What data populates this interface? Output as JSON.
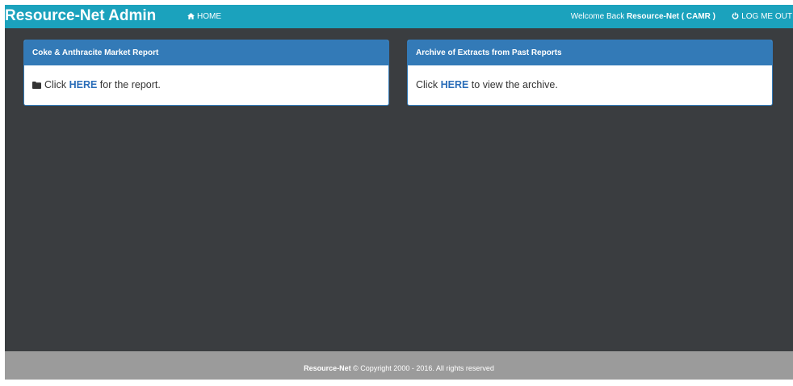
{
  "navbar": {
    "brand": "Resource-Net Admin",
    "home_label": "HOME",
    "home_icon": "home-icon",
    "welcome_prefix": "Welcome Back",
    "welcome_user": "Resource-Net ( CAMR )",
    "logout_label": "LOG ME OUT",
    "logout_icon": "power-icon",
    "color": "#1ba2bd"
  },
  "panels": [
    {
      "title": "Coke & Anthracite Market Report",
      "icon": "folder-icon",
      "body_prefix": "Click",
      "link_text": "HERE",
      "body_suffix": "for the report."
    },
    {
      "title": "Archive of Extracts from Past Reports",
      "body_prefix": "Click",
      "link_text": "HERE",
      "body_suffix": "to view the archive."
    }
  ],
  "footer": {
    "brand": "Resource-Net",
    "copyright": "© Copyright 2000 - 2016. All rights reserved",
    "color": "#9b9b9b"
  },
  "colors": {
    "page_background": "#3a3d40",
    "panel_heading": "#337ab7"
  }
}
